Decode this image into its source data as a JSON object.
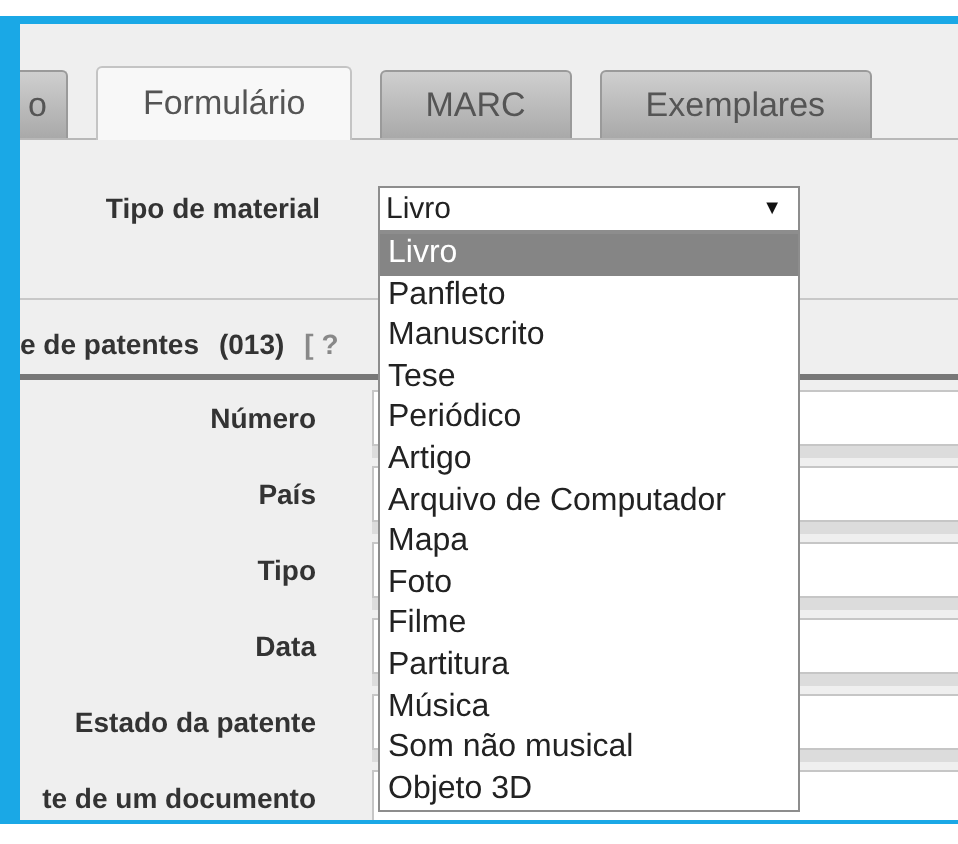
{
  "tabs": [
    {
      "label": "o",
      "selected": false
    },
    {
      "label": "Formulário",
      "selected": true
    },
    {
      "label": "MARC",
      "selected": false
    },
    {
      "label": "Exemplares",
      "selected": false
    }
  ],
  "material": {
    "label": "Tipo de material",
    "value": "Livro",
    "arrow": "▼"
  },
  "options": [
    {
      "label": "Livro",
      "selected": true
    },
    {
      "label": "Panfleto",
      "selected": false
    },
    {
      "label": "Manuscrito",
      "selected": false
    },
    {
      "label": "Tese",
      "selected": false
    },
    {
      "label": "Periódico",
      "selected": false
    },
    {
      "label": "Artigo",
      "selected": false
    },
    {
      "label": "Arquivo de Computador",
      "selected": false
    },
    {
      "label": "Mapa",
      "selected": false
    },
    {
      "label": "Foto",
      "selected": false
    },
    {
      "label": "Filme",
      "selected": false
    },
    {
      "label": "Partitura",
      "selected": false
    },
    {
      "label": "Música",
      "selected": false
    },
    {
      "label": "Som não musical",
      "selected": false
    },
    {
      "label": "Objeto 3D",
      "selected": false
    }
  ],
  "section": {
    "title": "e de patentes",
    "code": "(013)",
    "help": "[ ?"
  },
  "fields": [
    {
      "label": "Número"
    },
    {
      "label": "País"
    },
    {
      "label": "Tipo"
    },
    {
      "label": "Data"
    },
    {
      "label": "Estado da patente"
    },
    {
      "label": "te de um documento"
    }
  ]
}
